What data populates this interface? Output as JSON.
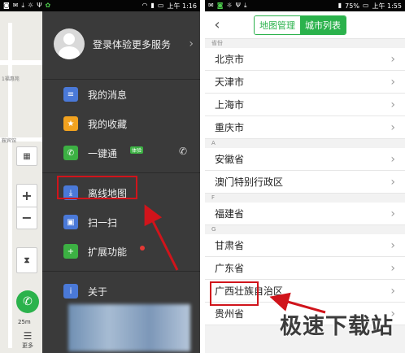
{
  "left": {
    "status": {
      "time": "上午 1:16"
    },
    "map": {
      "labels": [
        "1福惠苑",
        "鞍宾馆"
      ],
      "zoom_in": "+",
      "zoom_out": "−",
      "scale": "25m",
      "more_label": "更多"
    },
    "drawer": {
      "login_text": "登录体验更多服务",
      "items": [
        {
          "label": "我的消息",
          "icon": "message-icon",
          "color": "#4a79d8"
        },
        {
          "label": "我的收藏",
          "icon": "star-icon",
          "color": "#f2a21f"
        },
        {
          "label": "一键通",
          "icon": "phone-icon",
          "color": "#3cb043",
          "badge": "体验"
        },
        {
          "label": "离线地图",
          "icon": "offline-map-icon",
          "color": "#4a79d8"
        },
        {
          "label": "扫一扫",
          "icon": "scan-icon",
          "color": "#4a79d8"
        },
        {
          "label": "扩展功能",
          "icon": "plus-icon",
          "color": "#3cb043"
        },
        {
          "label": "关于",
          "icon": "info-icon",
          "color": "#4a79d8"
        }
      ]
    }
  },
  "right": {
    "status": {
      "battery": "75%",
      "time": "上午 1:55"
    },
    "tabs": {
      "offline": "地图管理",
      "city_list": "城市列表"
    },
    "sections": [
      {
        "header": "省份",
        "cities": [
          "北京市",
          "天津市",
          "上海市",
          "重庆市"
        ]
      },
      {
        "header": "A",
        "cities": [
          "安徽省",
          "澳门特别行政区"
        ]
      },
      {
        "header": "F",
        "cities": [
          "福建省"
        ]
      },
      {
        "header": "G",
        "cities": [
          "甘肃省",
          "广东省",
          "广西壮族自治区",
          "贵州省"
        ]
      }
    ]
  },
  "watermark": "极速下载站"
}
